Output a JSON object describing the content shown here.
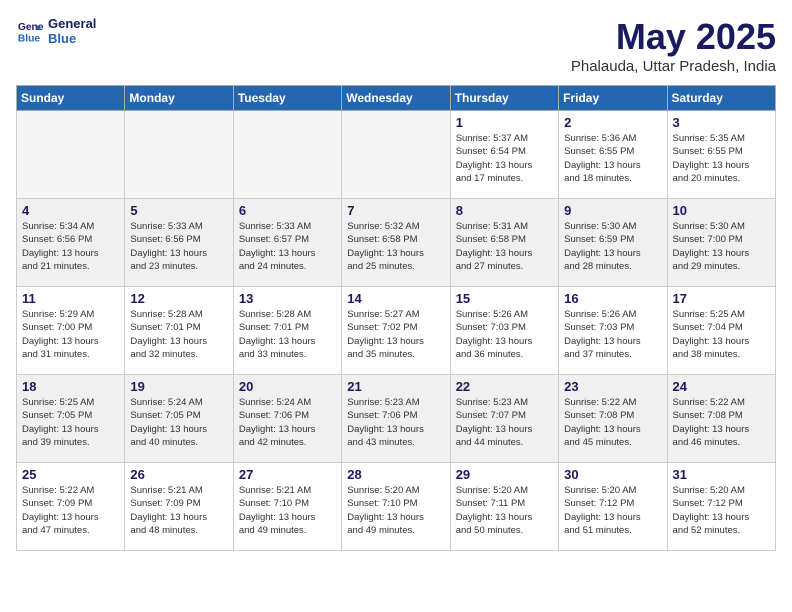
{
  "header": {
    "logo_line1": "General",
    "logo_line2": "Blue",
    "month_year": "May 2025",
    "location": "Phalauda, Uttar Pradesh, India"
  },
  "weekdays": [
    "Sunday",
    "Monday",
    "Tuesday",
    "Wednesday",
    "Thursday",
    "Friday",
    "Saturday"
  ],
  "weeks": [
    [
      {
        "day": "",
        "detail": "",
        "empty": true
      },
      {
        "day": "",
        "detail": "",
        "empty": true
      },
      {
        "day": "",
        "detail": "",
        "empty": true
      },
      {
        "day": "",
        "detail": "",
        "empty": true
      },
      {
        "day": "1",
        "detail": "Sunrise: 5:37 AM\nSunset: 6:54 PM\nDaylight: 13 hours\nand 17 minutes."
      },
      {
        "day": "2",
        "detail": "Sunrise: 5:36 AM\nSunset: 6:55 PM\nDaylight: 13 hours\nand 18 minutes."
      },
      {
        "day": "3",
        "detail": "Sunrise: 5:35 AM\nSunset: 6:55 PM\nDaylight: 13 hours\nand 20 minutes."
      }
    ],
    [
      {
        "day": "4",
        "detail": "Sunrise: 5:34 AM\nSunset: 6:56 PM\nDaylight: 13 hours\nand 21 minutes."
      },
      {
        "day": "5",
        "detail": "Sunrise: 5:33 AM\nSunset: 6:56 PM\nDaylight: 13 hours\nand 23 minutes."
      },
      {
        "day": "6",
        "detail": "Sunrise: 5:33 AM\nSunset: 6:57 PM\nDaylight: 13 hours\nand 24 minutes."
      },
      {
        "day": "7",
        "detail": "Sunrise: 5:32 AM\nSunset: 6:58 PM\nDaylight: 13 hours\nand 25 minutes."
      },
      {
        "day": "8",
        "detail": "Sunrise: 5:31 AM\nSunset: 6:58 PM\nDaylight: 13 hours\nand 27 minutes."
      },
      {
        "day": "9",
        "detail": "Sunrise: 5:30 AM\nSunset: 6:59 PM\nDaylight: 13 hours\nand 28 minutes."
      },
      {
        "day": "10",
        "detail": "Sunrise: 5:30 AM\nSunset: 7:00 PM\nDaylight: 13 hours\nand 29 minutes."
      }
    ],
    [
      {
        "day": "11",
        "detail": "Sunrise: 5:29 AM\nSunset: 7:00 PM\nDaylight: 13 hours\nand 31 minutes."
      },
      {
        "day": "12",
        "detail": "Sunrise: 5:28 AM\nSunset: 7:01 PM\nDaylight: 13 hours\nand 32 minutes."
      },
      {
        "day": "13",
        "detail": "Sunrise: 5:28 AM\nSunset: 7:01 PM\nDaylight: 13 hours\nand 33 minutes."
      },
      {
        "day": "14",
        "detail": "Sunrise: 5:27 AM\nSunset: 7:02 PM\nDaylight: 13 hours\nand 35 minutes."
      },
      {
        "day": "15",
        "detail": "Sunrise: 5:26 AM\nSunset: 7:03 PM\nDaylight: 13 hours\nand 36 minutes."
      },
      {
        "day": "16",
        "detail": "Sunrise: 5:26 AM\nSunset: 7:03 PM\nDaylight: 13 hours\nand 37 minutes."
      },
      {
        "day": "17",
        "detail": "Sunrise: 5:25 AM\nSunset: 7:04 PM\nDaylight: 13 hours\nand 38 minutes."
      }
    ],
    [
      {
        "day": "18",
        "detail": "Sunrise: 5:25 AM\nSunset: 7:05 PM\nDaylight: 13 hours\nand 39 minutes."
      },
      {
        "day": "19",
        "detail": "Sunrise: 5:24 AM\nSunset: 7:05 PM\nDaylight: 13 hours\nand 40 minutes."
      },
      {
        "day": "20",
        "detail": "Sunrise: 5:24 AM\nSunset: 7:06 PM\nDaylight: 13 hours\nand 42 minutes."
      },
      {
        "day": "21",
        "detail": "Sunrise: 5:23 AM\nSunset: 7:06 PM\nDaylight: 13 hours\nand 43 minutes."
      },
      {
        "day": "22",
        "detail": "Sunrise: 5:23 AM\nSunset: 7:07 PM\nDaylight: 13 hours\nand 44 minutes."
      },
      {
        "day": "23",
        "detail": "Sunrise: 5:22 AM\nSunset: 7:08 PM\nDaylight: 13 hours\nand 45 minutes."
      },
      {
        "day": "24",
        "detail": "Sunrise: 5:22 AM\nSunset: 7:08 PM\nDaylight: 13 hours\nand 46 minutes."
      }
    ],
    [
      {
        "day": "25",
        "detail": "Sunrise: 5:22 AM\nSunset: 7:09 PM\nDaylight: 13 hours\nand 47 minutes."
      },
      {
        "day": "26",
        "detail": "Sunrise: 5:21 AM\nSunset: 7:09 PM\nDaylight: 13 hours\nand 48 minutes."
      },
      {
        "day": "27",
        "detail": "Sunrise: 5:21 AM\nSunset: 7:10 PM\nDaylight: 13 hours\nand 49 minutes."
      },
      {
        "day": "28",
        "detail": "Sunrise: 5:20 AM\nSunset: 7:10 PM\nDaylight: 13 hours\nand 49 minutes."
      },
      {
        "day": "29",
        "detail": "Sunrise: 5:20 AM\nSunset: 7:11 PM\nDaylight: 13 hours\nand 50 minutes."
      },
      {
        "day": "30",
        "detail": "Sunrise: 5:20 AM\nSunset: 7:12 PM\nDaylight: 13 hours\nand 51 minutes."
      },
      {
        "day": "31",
        "detail": "Sunrise: 5:20 AM\nSunset: 7:12 PM\nDaylight: 13 hours\nand 52 minutes."
      }
    ]
  ]
}
